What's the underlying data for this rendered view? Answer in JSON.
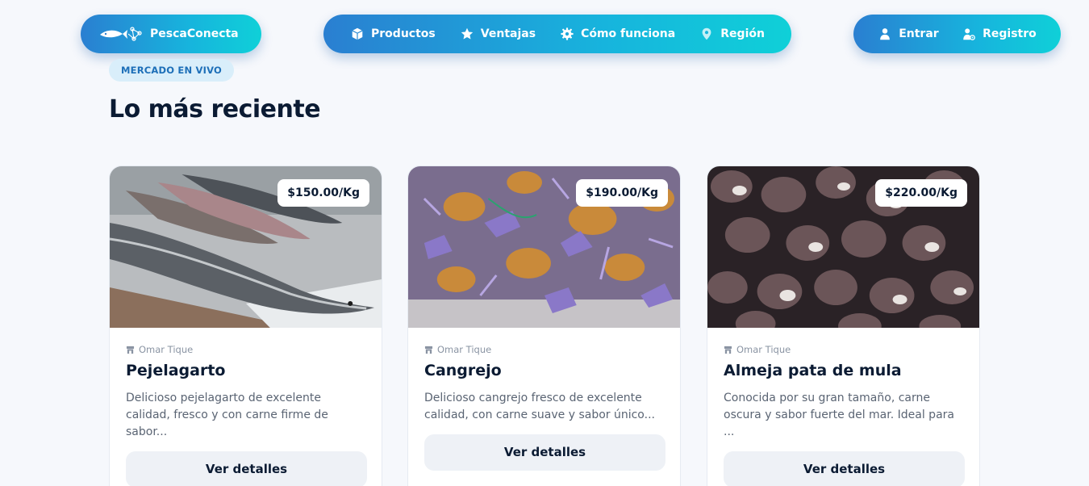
{
  "brand": {
    "name": "PescaConecta",
    "logo_icon": "fish-network-icon"
  },
  "nav": {
    "items": [
      {
        "label": "Productos",
        "icon": "box-icon"
      },
      {
        "label": "Ventajas",
        "icon": "star-icon"
      },
      {
        "label": "Cómo funciona",
        "icon": "gear-icon"
      },
      {
        "label": "Región",
        "icon": "map-pin-icon"
      }
    ]
  },
  "auth": {
    "login_label": "Entrar",
    "register_label": "Registro"
  },
  "section": {
    "badge": "MERCADO EN VIVO",
    "title": "Lo más reciente"
  },
  "products": [
    {
      "price": "$150.00/Kg",
      "seller": "Omar Tique",
      "name": "Pejelagarto",
      "description": "Delicioso pejelagarto de excelente calidad, fresco y con carne firme de sabor...",
      "button": "Ver detalles"
    },
    {
      "price": "$190.00/Kg",
      "seller": "Omar Tique",
      "name": "Cangrejo",
      "description": "Delicioso cangrejo fresco de excelente calidad, con carne suave y sabor único...",
      "button": "Ver detalles"
    },
    {
      "price": "$220.00/Kg",
      "seller": "Omar Tique",
      "name": "Almeja pata de mula",
      "description": "Conocida por su gran tamaño, carne oscura y sabor fuerte del mar. Ideal para ...",
      "button": "Ver detalles"
    }
  ],
  "colors": {
    "gradient_start": "#2a7fd1",
    "gradient_end": "#0fd0d8",
    "page_bg": "#f6f8fc",
    "badge_bg": "#d9eefa",
    "badge_text": "#1d6fb8",
    "heading": "#0b1b33"
  }
}
